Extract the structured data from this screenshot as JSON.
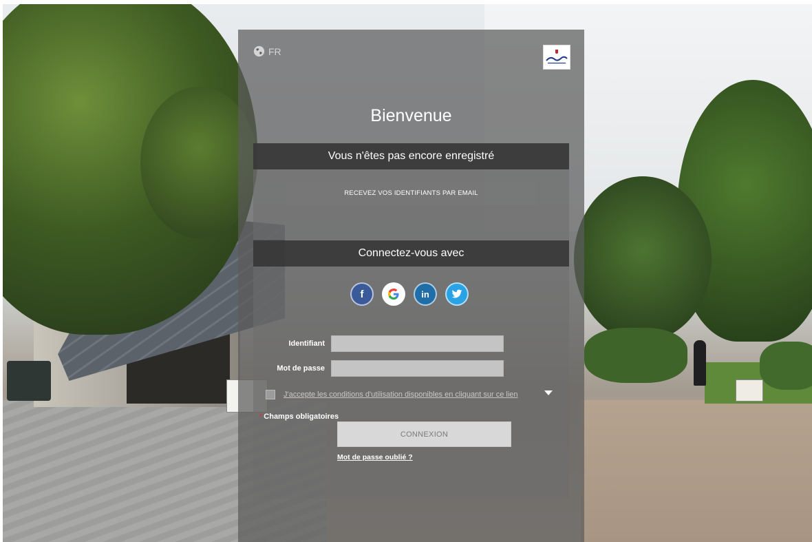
{
  "lang": {
    "code": "FR"
  },
  "title": "Bienvenue",
  "register": {
    "heading": "Vous n'êtes pas encore enregistré",
    "email_button": "RECEVEZ VOS IDENTIFIANTS PAR EMAIL"
  },
  "connect_with": {
    "heading": "Connectez-vous avec",
    "providers": [
      {
        "icon": "facebook-icon",
        "glyph": "f"
      },
      {
        "icon": "google-icon",
        "glyph": "G"
      },
      {
        "icon": "linkedin-icon",
        "glyph": "in"
      },
      {
        "icon": "twitter-icon",
        "glyph": ""
      }
    ]
  },
  "form": {
    "login_label": "Identifiant",
    "password_label": "Mot de passe",
    "terms_text": "J'accepte les conditions d'utilisation disponibles en cliquant sur ce lien",
    "required_note": "Champs obligatoires",
    "required_star": "*",
    "submit_label": "CONNEXION",
    "forgot_label": "Mot de passe oublié ?"
  },
  "colors": {
    "facebook": "#3b5a9a",
    "linkedin": "#1f6ea8",
    "twitter": "#2aa3e6",
    "required_star": "#d23a3a"
  }
}
